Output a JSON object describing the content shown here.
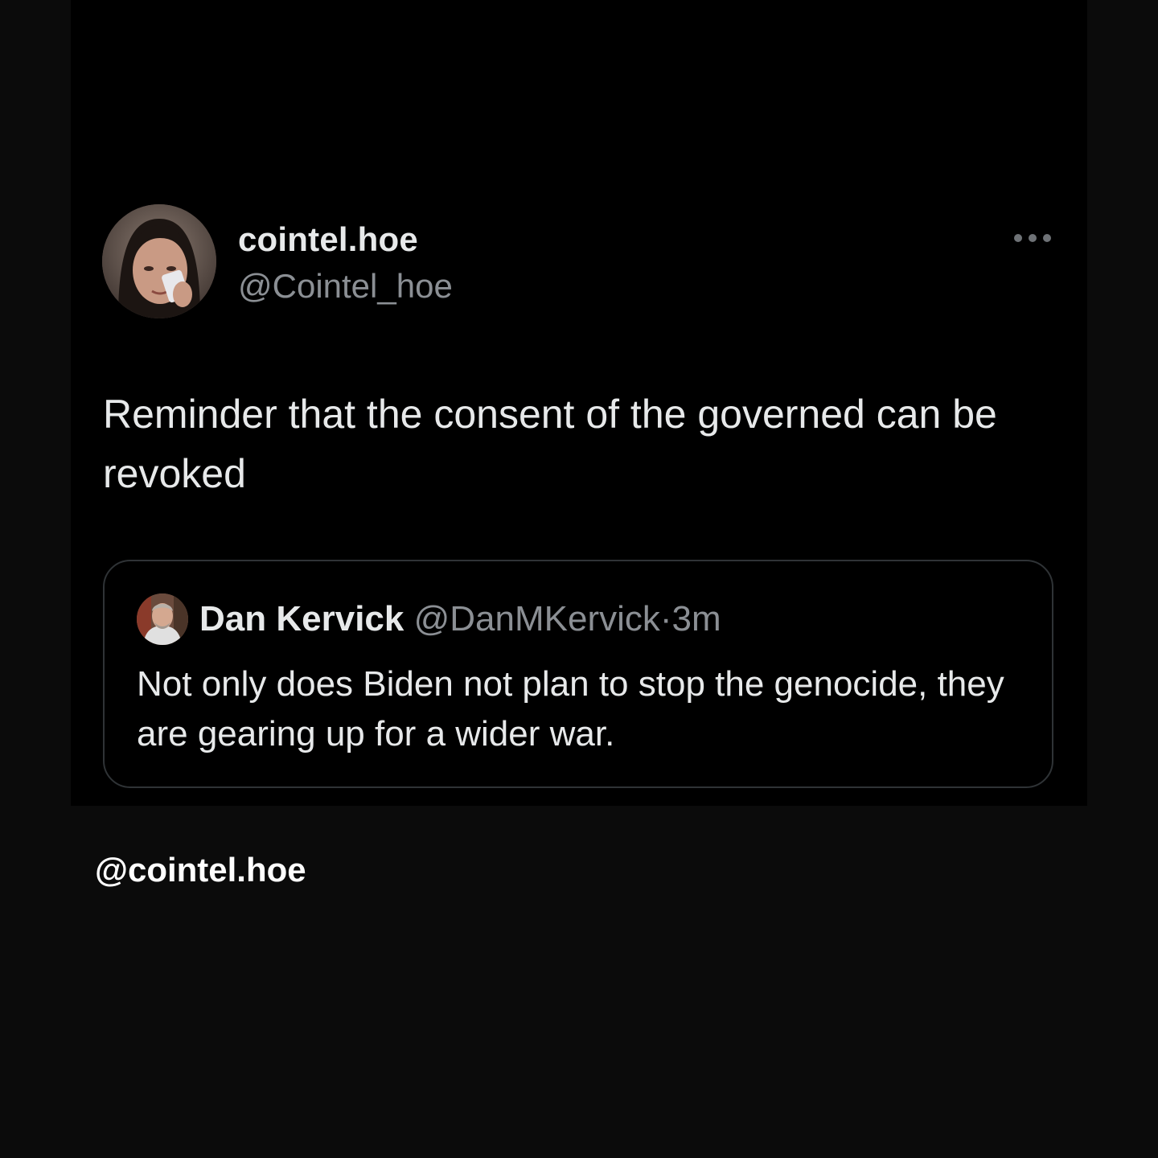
{
  "tweet": {
    "display_name": "cointel.hoe",
    "handle": "@Cointel_hoe",
    "text": "Reminder that the consent of the governed can be revoked",
    "more_icon": "more-horizontal-icon",
    "avatar_icon": "user-avatar"
  },
  "quoted_tweet": {
    "display_name": "Dan Kervick",
    "handle": "@DanMKervick",
    "separator": "·",
    "time": "3m",
    "text": "Not only does Biden not plan to stop the genocide, they are gearing up for a wider war.",
    "avatar_icon": "user-avatar"
  },
  "watermark": "@cointel.hoe",
  "colors": {
    "background": "#0b0b0b",
    "card": "#000000",
    "primary_text": "#e7e9ea",
    "secondary_text": "#8b8f94",
    "border": "#2f3336"
  }
}
